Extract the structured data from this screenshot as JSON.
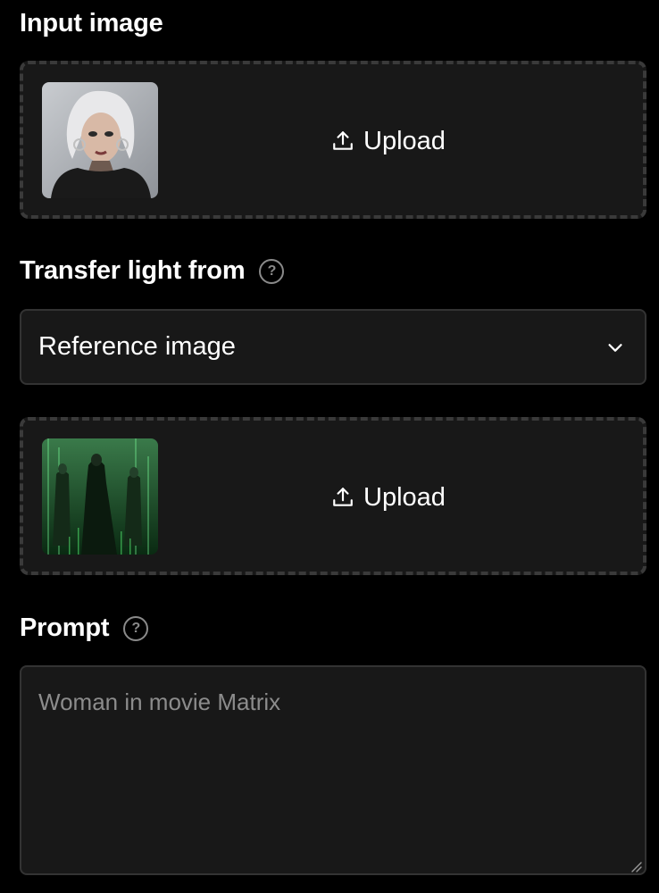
{
  "input_image": {
    "title": "Input image",
    "upload_label": "Upload"
  },
  "transfer_light": {
    "title": "Transfer light from",
    "help_glyph": "?",
    "selected": "Reference image"
  },
  "reference_image": {
    "upload_label": "Upload"
  },
  "prompt": {
    "title": "Prompt",
    "help_glyph": "?",
    "placeholder": "Woman in movie Matrix",
    "value": ""
  },
  "icons": {
    "upload": "upload-icon",
    "help": "help-circle-icon",
    "dropdown": "chevron-down-icon",
    "resize": "resize-grip-icon"
  },
  "colors": {
    "background": "#000000",
    "panel": "#181818",
    "border": "#333333",
    "dashed_border": "#3a3a3a",
    "muted": "#8a8a8a"
  }
}
